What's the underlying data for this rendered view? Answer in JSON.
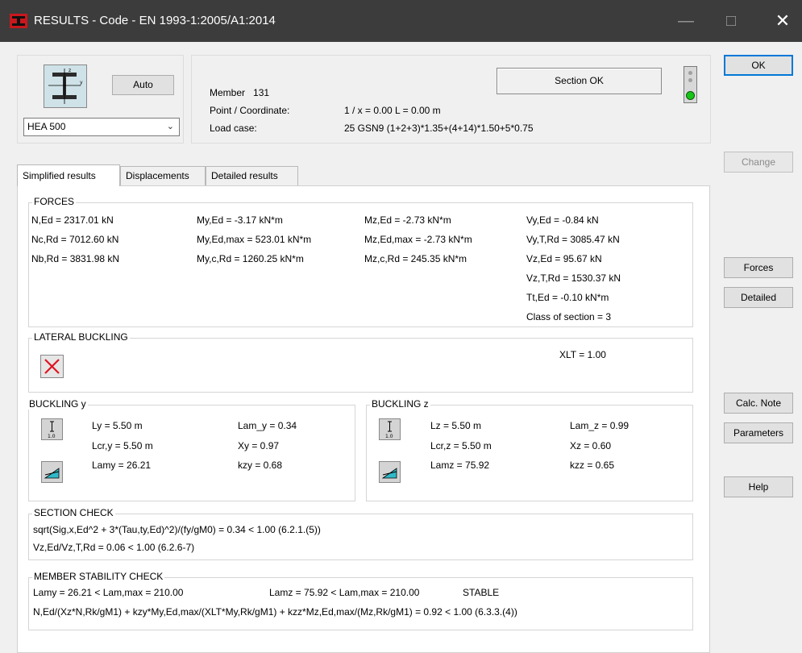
{
  "window": {
    "title": "RESULTS - Code - EN 1993-1:2005/A1:2014",
    "minimize": "—",
    "maximize": "□",
    "close": "✕"
  },
  "profile": {
    "auto_label": "Auto",
    "selected": "HEA 500"
  },
  "info": {
    "member_label": "Member",
    "member_value": "131",
    "point_label": "Point / Coordinate:",
    "point_value": "1 / x = 0.00 L = 0.00 m",
    "loadcase_label": "Load case:",
    "loadcase_value": "25 GSN9  (1+2+3)*1.35+(4+14)*1.50+5*0.75",
    "section_status": "Section OK",
    "status_color": "#18c418"
  },
  "tabs": [
    {
      "label": "Simplified results"
    },
    {
      "label": "Displacements"
    },
    {
      "label": "Detailed results"
    }
  ],
  "forces": {
    "title": "FORCES",
    "col1": [
      "N,Ed = 2317.01 kN",
      "Nc,Rd = 7012.60 kN",
      "Nb,Rd = 3831.98 kN"
    ],
    "col2": [
      "My,Ed = -3.17 kN*m",
      "My,Ed,max = 523.01 kN*m",
      "My,c,Rd = 1260.25 kN*m"
    ],
    "col3": [
      "Mz,Ed = -2.73 kN*m",
      "Mz,Ed,max = -2.73 kN*m",
      "Mz,c,Rd = 245.35 kN*m"
    ],
    "col4": [
      "Vy,Ed = -0.84 kN",
      "Vy,T,Rd = 3085.47 kN",
      "Vz,Ed = 95.67 kN",
      "Vz,T,Rd = 1530.37 kN",
      "Tt,Ed = -0.10 kN*m",
      "Class of section = 3"
    ]
  },
  "lateral": {
    "title": "LATERAL BUCKLING",
    "xlt": "XLT = 1.00"
  },
  "buckling_y": {
    "title": "BUCKLING y",
    "icon_label": "1.0",
    "l": "Ly = 5.50 m",
    "lcr": "Lcr,y = 5.50 m",
    "lam": "Lamy = 26.21",
    "lam_rel": "Lam_y = 0.34",
    "x": "Xy = 0.97",
    "k": "kzy = 0.68"
  },
  "buckling_z": {
    "title": "BUCKLING z",
    "icon_label": "1.0",
    "l": "Lz = 5.50 m",
    "lcr": "Lcr,z = 5.50 m",
    "lam": "Lamz = 75.92",
    "lam_rel": "Lam_z = 0.99",
    "x": "Xz = 0.60",
    "k": "kzz = 0.65"
  },
  "section_check": {
    "title": "SECTION CHECK",
    "line1": "sqrt(Sig,x,Ed^2 + 3*(Tau,ty,Ed)^2)/(fy/gM0) = 0.34 < 1.00   (6.2.1.(5))",
    "line2": "Vz,Ed/Vz,T,Rd = 0.06 < 1.00   (6.2.6-7)"
  },
  "stability_check": {
    "title": "MEMBER STABILITY CHECK",
    "line1a": "Lamy = 26.21 < Lam,max = 210.00",
    "line1b": "Lamz = 75.92 < Lam,max = 210.00",
    "line1c": "STABLE",
    "line2": "N,Ed/(Xz*N,Rk/gM1) + kzy*My,Ed,max/(XLT*My,Rk/gM1) + kzz*Mz,Ed,max/(Mz,Rk/gM1) = 0.92 < 1.00   (6.3.3.(4))"
  },
  "buttons": {
    "ok": "OK",
    "change": "Change",
    "forces": "Forces",
    "detailed": "Detailed",
    "calc_note": "Calc. Note",
    "parameters": "Parameters",
    "help": "Help"
  }
}
